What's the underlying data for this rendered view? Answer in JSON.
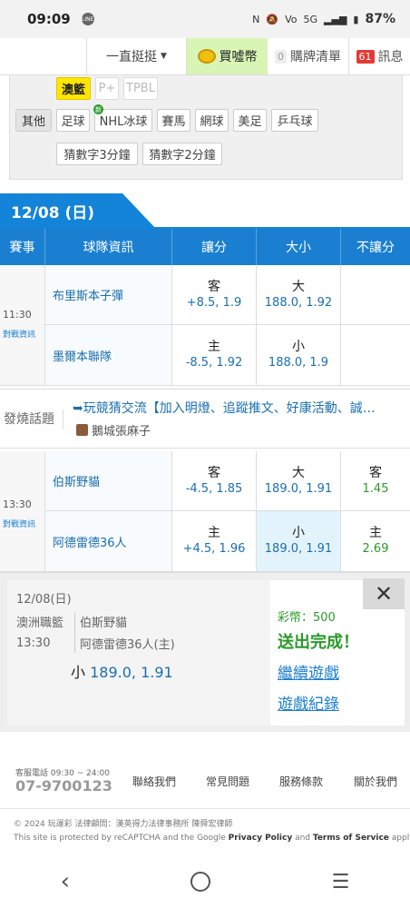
{
  "status_bar": {
    "time": "09:09",
    "network": "5G",
    "battery": "87%"
  },
  "top_nav": {
    "dropdown_label": "一直挺挺",
    "buy_label": "買噓幣",
    "cart_count": "0",
    "cart_label": "購牌清單",
    "msg_count": "61",
    "msg_label": "訊息"
  },
  "filter": {
    "row1": [
      "澳籃",
      "P+",
      "TPBL"
    ],
    "other_label": "其他",
    "row2": [
      "足球",
      "NHL冰球",
      "賽馬",
      "網球",
      "美足",
      "乒乓球"
    ],
    "new_mark": "新",
    "row3": [
      "猜數字3分鐘",
      "猜數字2分鐘"
    ]
  },
  "date_header": "12/08 (日)",
  "table_headers": [
    "賽事",
    "球隊資訊",
    "讓分",
    "大小",
    "不讓分"
  ],
  "games": [
    {
      "time": "11:30",
      "info_label": "對戰資訊",
      "home": {
        "team": "布里斯本子彈",
        "spread_k": "客",
        "spread_v": "+8.5, 1.9",
        "total_k": "大",
        "total_v": "188.0, 1.92",
        "ml_k": "",
        "ml_v": ""
      },
      "away": {
        "team": "墨爾本聯隊",
        "spread_k": "主",
        "spread_v": "-8.5, 1.92",
        "total_k": "小",
        "total_v": "188.0, 1.9",
        "ml_k": "",
        "ml_v": ""
      }
    },
    {
      "time": "13:30",
      "info_label": "對戰資訊",
      "home": {
        "team": "伯斯野貓",
        "spread_k": "客",
        "spread_v": "-4.5, 1.85",
        "total_k": "大",
        "total_v": "189.0, 1.91",
        "ml_k": "客",
        "ml_v": "1.45"
      },
      "away": {
        "team": "阿德雷德36人",
        "spread_k": "主",
        "spread_v": "+4.5, 1.96",
        "total_k": "小",
        "total_v": "189.0, 1.91",
        "ml_k": "主",
        "ml_v": "2.69"
      }
    }
  ],
  "hot_topic": {
    "label": "發燒話題",
    "title": "➥玩競猜交流【加入明燈、追蹤推文、好康活動、誠…",
    "author": "鵝城張麻子"
  },
  "bet_popup": {
    "date": "12/08(日)",
    "league": "澳洲職籃",
    "time": "13:30",
    "team1": "伯斯野貓",
    "team2": "阿德雷德36人(主)",
    "bet_pick": "小",
    "bet_odds": "189.0, 1.91",
    "coin_text": "彩幣：500",
    "sent_text": "送出完成！",
    "continue_link": "繼續遊戲",
    "record_link": "遊戲紀錄",
    "close_icon": "✕"
  },
  "footer": {
    "service_hours": "客服電話 09:30 ~ 24:00",
    "phone": "07-9700123",
    "links": [
      "聯絡我們",
      "常見問題",
      "服務條款",
      "關於我們"
    ],
    "copyright": "© 2024 玩運彩 法律顧問：漢英得力法律事務所 陳舜宏律師",
    "recaptcha_pre": "This site is protected by reCAPTCHA and the Google ",
    "privacy": "Privacy Policy",
    "and": " and ",
    "terms": "Terms of Service",
    "apply": " apply."
  }
}
